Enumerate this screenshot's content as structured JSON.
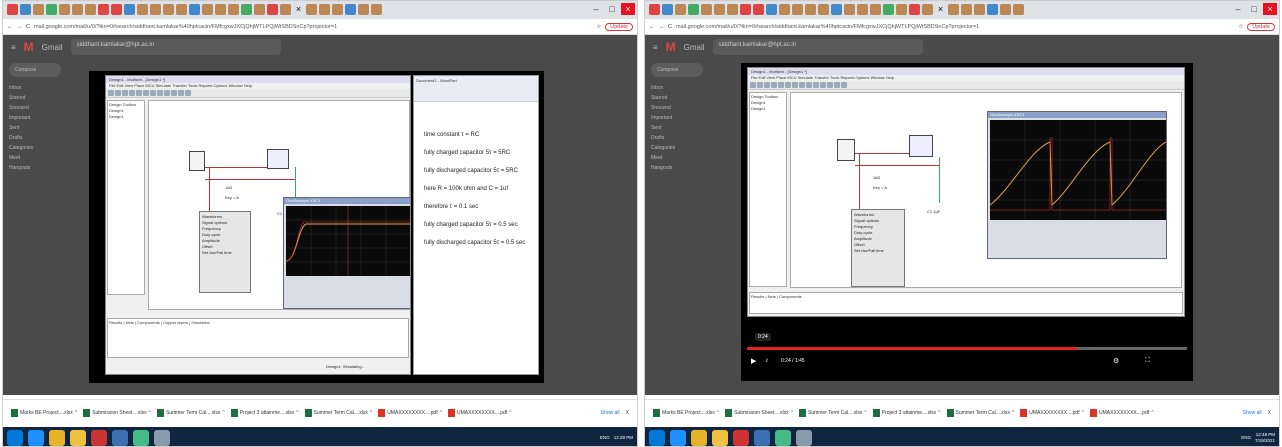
{
  "browser": {
    "url": "mail.google.com/mail/u/0/?tkn=0#search/siddhant.kamlakar%40hptcacin/FMfcgxwJXCjQhjWTLPQjWtSBDSnCp?projector=1",
    "update_label": "Update"
  },
  "gmail": {
    "search_query": "siddhant.kamlakar@hpt.ac.in",
    "compose_label": "Compose",
    "sidebar_items": [
      "Inbox",
      "Starred",
      "Snoozed",
      "Important",
      "Sent",
      "Drafts",
      "Categories",
      "Meet",
      "Hangouts"
    ]
  },
  "multisim": {
    "title": "Design1 - Multisim - [Design1 *]",
    "menu": "File  Edit  View  Place  MCU  Simulate  Transfer  Tools  Reports  Options  Window  Help",
    "design_toolbox_label": "Design Toolbox",
    "tree_items": [
      "Design1",
      "Design1"
    ],
    "tabs": [
      "Results",
      "Nets",
      "Components",
      "Copper layers",
      "Simulation"
    ],
    "status": "Design1: Simulating...",
    "component_r": "1kΩ",
    "component_c": "C1 1µF",
    "switch_label": "Key = A"
  },
  "word": {
    "title": "Document1 - WordPad",
    "notes": [
      "time constant τ = RC",
      "fully charged capacitor 5τ = 5RC",
      "fully discharged capacitor 5τ = 5RC",
      "here R = 100k ohm and C =  1uf",
      "therefore τ = 0.1 sec",
      "fully charged capacitor 5τ = 0.5 sec",
      "fully discharged capacitor 5τ = 0.5 sec"
    ]
  },
  "video": {
    "timestamp_tip": "0:24",
    "time_label": "0:24 / 1:45",
    "progress": 0.75
  },
  "downloads": {
    "items": [
      {
        "name": "Marks BE Project....xlsx",
        "type": "xls"
      },
      {
        "name": "Submission Sheet....xlsx",
        "type": "xls"
      },
      {
        "name": "Summer Term Cal....xlsx",
        "type": "xls"
      },
      {
        "name": "Project 3 attainme....xlsx",
        "type": "xls"
      },
      {
        "name": "Summer Term Cal....xlsx",
        "type": "xls"
      },
      {
        "name": "UMAXXXXXXXX....pdf",
        "type": "pdf"
      },
      {
        "name": "UMAXXXXXXXX....pdf",
        "type": "pdf"
      }
    ],
    "show_all": "Show all",
    "close": "X"
  },
  "taskbar": {
    "time_left": "12:28 PM",
    "time_right": "12:48 PM",
    "date": "7/19/2021",
    "lang": "ENG"
  },
  "colors": {
    "wire": "#b33333",
    "progress": "#e52121",
    "trace": "#d8a35a"
  }
}
